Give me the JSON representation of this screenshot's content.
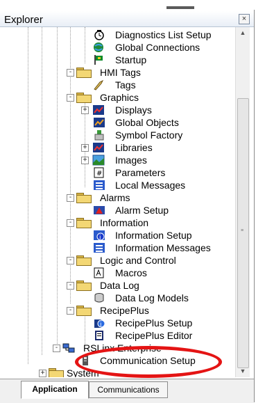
{
  "window": {
    "title": "Explorer",
    "close_glyph": "×"
  },
  "tree": {
    "items": [
      {
        "label": "Diagnostics List Setup",
        "icon": "diagnostics-list-icon"
      },
      {
        "label": "Global Connections",
        "icon": "global-connections-icon"
      },
      {
        "label": "Startup",
        "icon": "startup-flag-icon"
      },
      {
        "label": "HMI Tags",
        "icon": "folder-icon",
        "expander": "-"
      },
      {
        "label": "Tags",
        "icon": "tags-icon"
      },
      {
        "label": "Graphics",
        "icon": "folder-icon",
        "expander": "-"
      },
      {
        "label": "Displays",
        "icon": "displays-icon",
        "expander": "+"
      },
      {
        "label": "Global Objects",
        "icon": "global-objects-icon"
      },
      {
        "label": "Symbol Factory",
        "icon": "symbol-factory-icon"
      },
      {
        "label": "Libraries",
        "icon": "libraries-icon",
        "expander": "+"
      },
      {
        "label": "Images",
        "icon": "images-icon",
        "expander": "+"
      },
      {
        "label": "Parameters",
        "icon": "parameters-icon"
      },
      {
        "label": "Local Messages",
        "icon": "local-messages-icon"
      },
      {
        "label": "Alarms",
        "icon": "folder-icon",
        "expander": "-"
      },
      {
        "label": "Alarm Setup",
        "icon": "alarm-setup-icon"
      },
      {
        "label": "Information",
        "icon": "folder-icon",
        "expander": "-"
      },
      {
        "label": "Information Setup",
        "icon": "information-setup-icon"
      },
      {
        "label": "Information Messages",
        "icon": "information-messages-icon"
      },
      {
        "label": "Logic and Control",
        "icon": "folder-icon",
        "expander": "-"
      },
      {
        "label": "Macros",
        "icon": "macros-icon"
      },
      {
        "label": "Data Log",
        "icon": "folder-icon",
        "expander": "-"
      },
      {
        "label": "Data Log Models",
        "icon": "data-log-models-icon"
      },
      {
        "label": "RecipePlus",
        "icon": "folder-icon",
        "expander": "-"
      },
      {
        "label": "RecipePlus Setup",
        "icon": "recipeplus-setup-icon"
      },
      {
        "label": "RecipePlus Editor",
        "icon": "recipeplus-editor-icon"
      },
      {
        "label": "RSLinx Enterprise",
        "icon": "rslinx-icon",
        "expander": "-"
      },
      {
        "label": "Communication Setup",
        "icon": "communication-setup-icon"
      },
      {
        "label": "System",
        "icon": "folder-icon",
        "expander": "+"
      }
    ]
  },
  "tabs": {
    "application": "Application",
    "communications": "Communications"
  },
  "scrollbar": {
    "up": "▲",
    "down": "▼",
    "grip": "≡"
  },
  "colors": {
    "highlight_ellipse": "#e41414",
    "folder": "#f3d774"
  }
}
